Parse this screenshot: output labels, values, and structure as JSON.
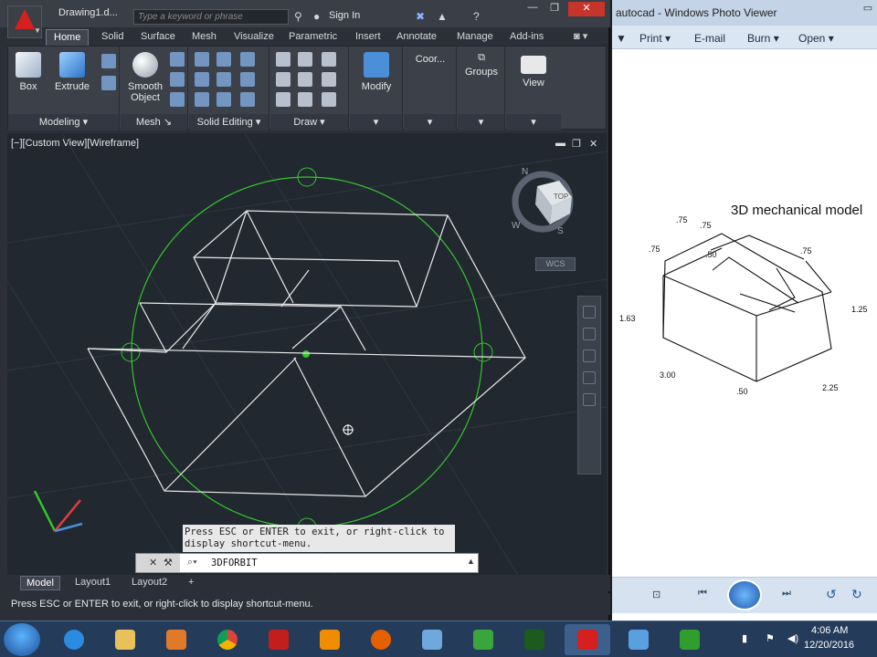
{
  "acad": {
    "doc_title": "Drawing1.d...",
    "search_placeholder": "Type a keyword or phrase",
    "sign_in": "Sign In",
    "tabs": [
      {
        "label": "Home"
      },
      {
        "label": "Solid"
      },
      {
        "label": "Surface"
      },
      {
        "label": "Mesh"
      },
      {
        "label": "Visualize"
      },
      {
        "label": "Parametric"
      },
      {
        "label": "Insert"
      },
      {
        "label": "Annotate"
      },
      {
        "label": "Manage"
      },
      {
        "label": "Add-ins"
      }
    ],
    "ribbon": {
      "box": "Box",
      "extrude": "Extrude",
      "smooth_object_1": "Smooth",
      "smooth_object_2": "Object",
      "modify": "Modify",
      "coord": "Coor...",
      "groups": "Groups",
      "view": "View",
      "panels": {
        "modeling": "Modeling",
        "mesh": "Mesh",
        "solid_editing": "Solid Editing",
        "draw": "Draw"
      }
    },
    "viewport_label": "[−][Custom View][Wireframe]",
    "viewcube_labels": {
      "n": "N",
      "w": "W",
      "s": "S",
      "face": "TOP"
    },
    "wcs": "WCS",
    "cmd_tooltip": "Press ESC or ENTER to exit, or right-click to display shortcut-menu.",
    "cmd_value": "3DFORBIT",
    "layout_tabs": [
      {
        "label": "Model"
      },
      {
        "label": "Layout1"
      },
      {
        "label": "Layout2"
      }
    ],
    "status_text": "Press ESC or ENTER to exit, or right-click to display shortcut-menu."
  },
  "photo_viewer": {
    "title": "autocad - Windows Photo Viewer",
    "menu": {
      "print": "Print",
      "email": "E-mail",
      "burn": "Burn",
      "open": "Open"
    },
    "caption": "3D mechanical model",
    "dims": {
      "d1": ".75",
      "d2": ".75",
      "d3": ".50",
      "d4": ".75",
      "d5": ".75",
      "d6": "1.63",
      "d7": "1.25",
      "d8": "3.00",
      "d9": ".50",
      "d10": "2.25"
    }
  },
  "taskbar": {
    "time": "4:06 AM",
    "date": "12/20/2016"
  },
  "colors": {
    "accent_red": "#d6201f",
    "wire": "#e8e8e8",
    "orbit": "#35c62c",
    "viewport_bg": "#212830"
  }
}
